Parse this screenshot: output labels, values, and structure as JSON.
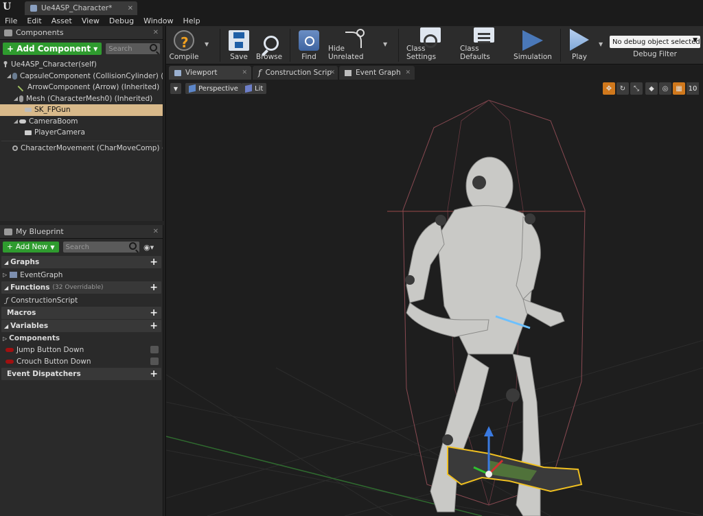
{
  "window": {
    "doc_tab": "Ue4ASP_Character*"
  },
  "menu": [
    "File",
    "Edit",
    "Asset",
    "View",
    "Debug",
    "Window",
    "Help"
  ],
  "components_panel": {
    "title": "Components",
    "add_button": "Add Component",
    "search_placeholder": "Search",
    "root": "Ue4ASP_Character(self)",
    "items": [
      {
        "label": "CapsuleComponent (CollisionCylinder) (Inherited)",
        "icon": "capsule-icon"
      },
      {
        "label": "ArrowComponent (Arrow) (Inherited)",
        "icon": "arrow-icon"
      },
      {
        "label": "Mesh (CharacterMesh0) (Inherited)",
        "icon": "skeletal-mesh-icon"
      },
      {
        "label": "SK_FPGun",
        "icon": "gun-icon"
      },
      {
        "label": "CameraBoom",
        "icon": "spring-arm-icon"
      },
      {
        "label": "PlayerCamera",
        "icon": "camera-icon"
      },
      {
        "label": "CharacterMovement (CharMoveComp) (Inherited)",
        "icon": "movement-icon"
      }
    ]
  },
  "my_blueprint": {
    "title": "My Blueprint",
    "add_button": "Add New",
    "search_placeholder": "Search",
    "sections": {
      "graphs": "Graphs",
      "event_graph": "EventGraph",
      "functions": "Functions",
      "functions_count": "(32 Overridable)",
      "construction_script": "ConstructionScript",
      "macros": "Macros",
      "variables": "Variables",
      "components": "Components",
      "var_jump": "Jump Button Down",
      "var_crouch": "Crouch Button Down",
      "event_dispatchers": "Event Dispatchers"
    }
  },
  "toolbar": {
    "compile": "Compile",
    "save": "Save",
    "browse": "Browse",
    "find": "Find",
    "hide_unrelated": "Hide Unrelated",
    "class_settings": "Class Settings",
    "class_defaults": "Class Defaults",
    "simulation": "Simulation",
    "play": "Play",
    "debug_select": "No debug object selected",
    "debug_filter": "Debug Filter"
  },
  "editor_tabs": {
    "viewport": "Viewport",
    "construction": "Construction Scrip",
    "event_graph": "Event Graph"
  },
  "viewport": {
    "perspective": "Perspective",
    "lit": "Lit",
    "grid_snap": "10"
  },
  "colors": {
    "add_green": "#2f9b2f",
    "selection": "#d8b98a",
    "gizmo_orange": "#d0781c"
  }
}
